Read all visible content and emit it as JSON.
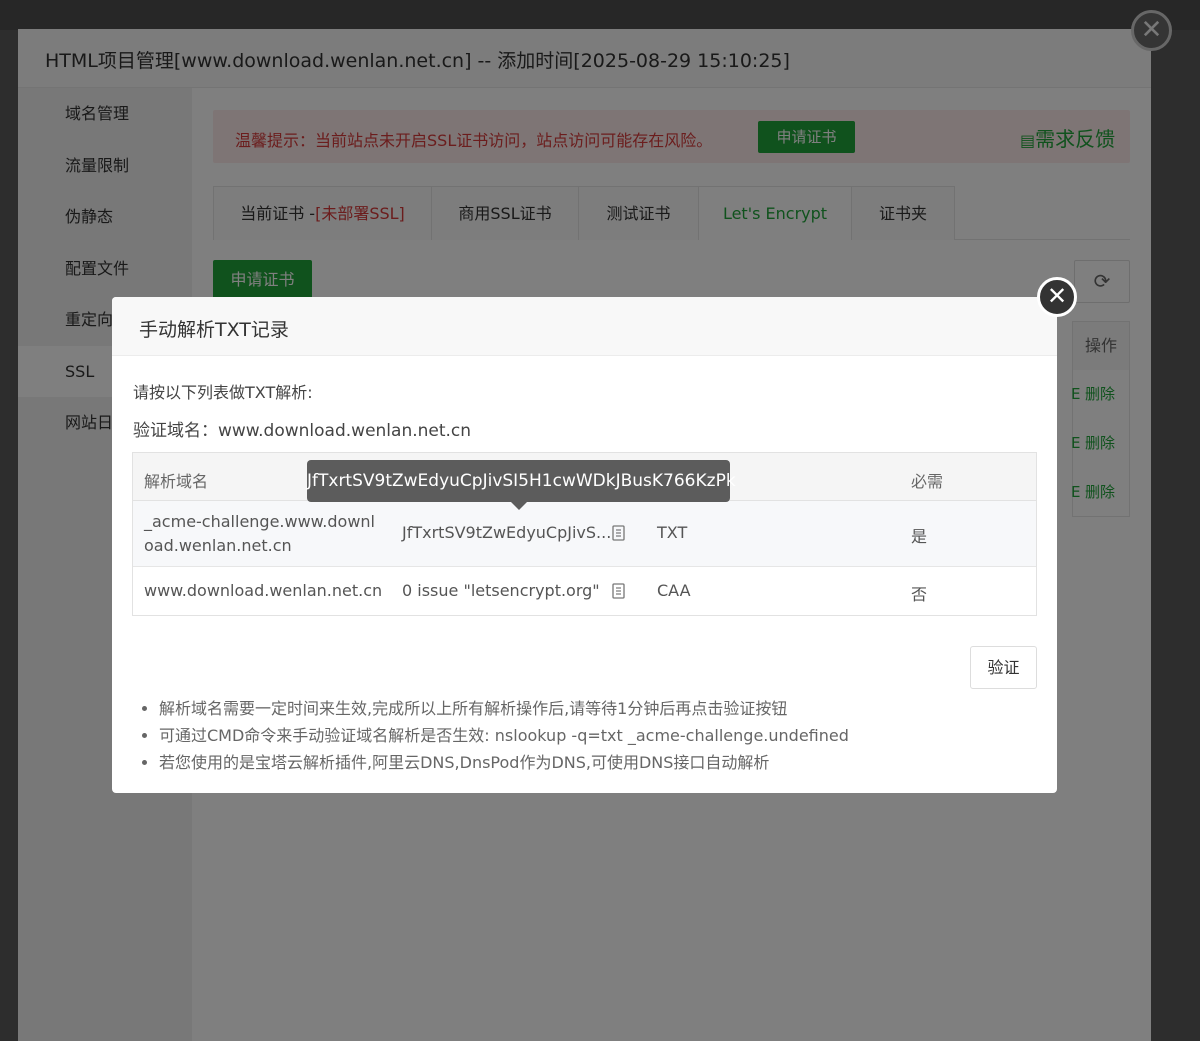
{
  "panel": {
    "title": "HTML项目管理[www.download.wenlan.net.cn] -- 添加时间[2025-08-29 15:10:25]",
    "close_icon": "✕"
  },
  "sidebar": {
    "items": [
      {
        "label": "域名管理"
      },
      {
        "label": "流量限制"
      },
      {
        "label": "伪静态"
      },
      {
        "label": "配置文件"
      },
      {
        "label": "重定向"
      },
      {
        "label": "SSL"
      },
      {
        "label": "网站日"
      }
    ],
    "active": "SSL"
  },
  "warning": {
    "text": "温馨提示：当前站点未开启SSL证书访问，站点访问可能存在风险。",
    "button": "申请证书",
    "feedback": "需求反馈"
  },
  "tabs": {
    "current_prefix": "当前证书 -",
    "current_status": "[未部署SSL]",
    "commercial": "商用SSL证书",
    "test": "测试证书",
    "letsencrypt": "Let's Encrypt",
    "folder": "证书夹"
  },
  "toolbar": {
    "apply_button": "申请证书",
    "refresh_icon": "⟳"
  },
  "cert_table": {
    "ops_header": "操作",
    "rows": [
      {
        "edge": "E",
        "delete": "删除"
      },
      {
        "edge": "E",
        "delete": "删除"
      },
      {
        "edge": "E",
        "delete": "删除"
      }
    ]
  },
  "modal": {
    "title": "手动解析TXT记录",
    "close_icon": "✕",
    "instruction": "请按以下列表做TXT解析:",
    "verify_domain_label": "验证域名：",
    "verify_domain": "www.download.wenlan.net.cn",
    "table": {
      "headers": {
        "host": "解析域名",
        "required": "必需"
      },
      "rows": [
        {
          "host": "_acme-challenge.www.download.wenlan.net.cn",
          "value": "JfTxrtSV9tZwEdyuCpJivS...",
          "type": "TXT",
          "required": "是"
        },
        {
          "host": "www.download.wenlan.net.cn",
          "value": "0 issue \"letsencrypt.org\"",
          "type": "CAA",
          "required": "否"
        }
      ]
    },
    "tooltip": "JfTxrtSV9tZwEdyuCpJivSI5H1cwWDkJBusK766KzPk",
    "verify_button": "验证",
    "notes": [
      "解析域名需要一定时间来生效,完成所以上所有解析操作后,请等待1分钟后再点击验证按钮",
      "可通过CMD命令来手动验证域名解析是否生效: nslookup -q=txt _acme-challenge.undefined",
      "若您使用的是宝塔云解析插件,阿里云DNS,DnsPod作为DNS,可使用DNS接口自动解析"
    ]
  }
}
